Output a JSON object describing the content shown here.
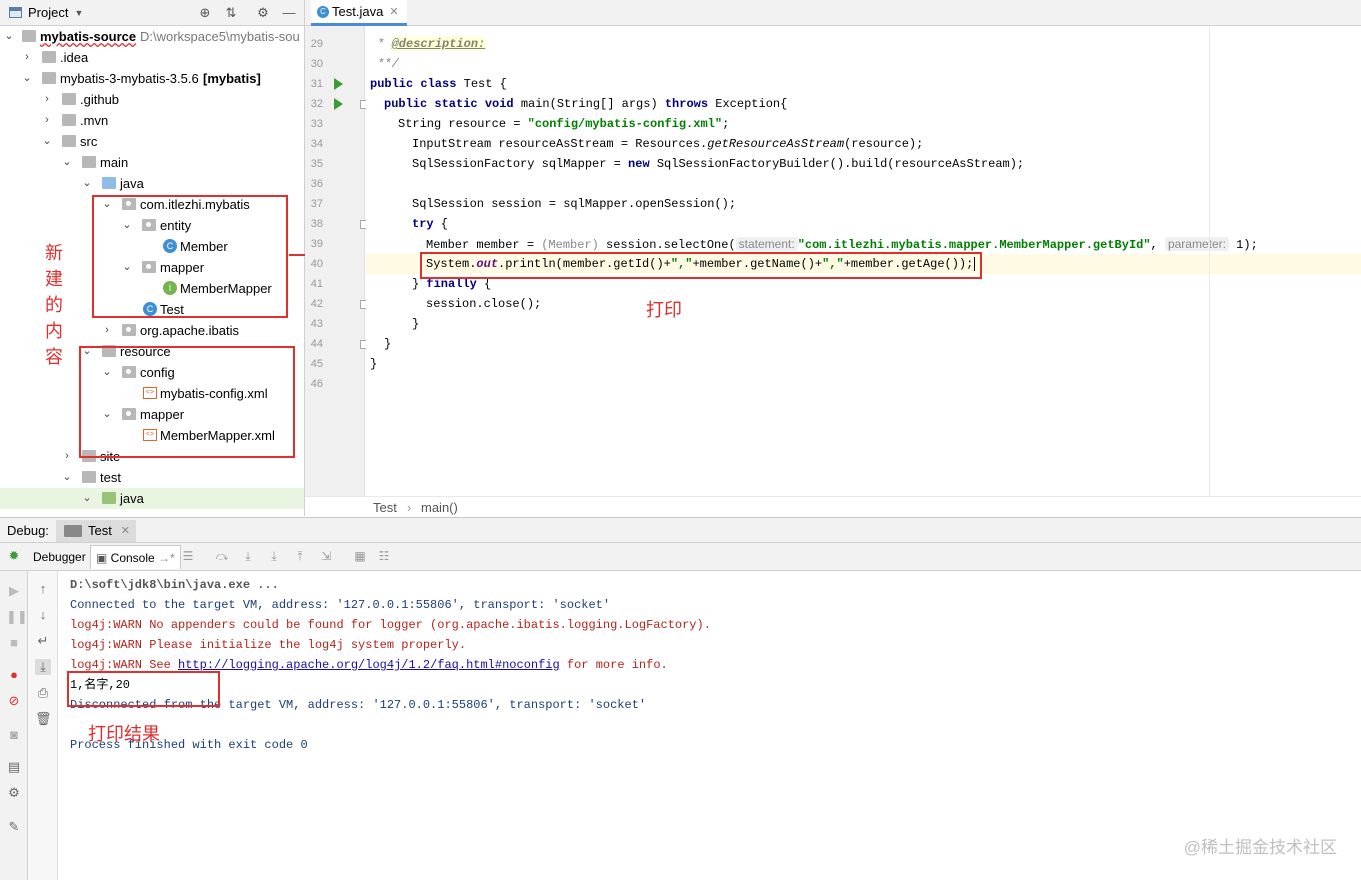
{
  "project_panel": {
    "title": "Project",
    "tree": [
      {
        "label": "mybatis-source",
        "suffix": "D:\\workspace5\\mybatis-sou",
        "bold": true
      },
      {
        "label": ".idea"
      },
      {
        "label": "mybatis-3-mybatis-3.5.6",
        "suffix": "[mybatis]"
      },
      {
        "label": ".github"
      },
      {
        "label": ".mvn"
      },
      {
        "label": "src"
      },
      {
        "label": "main"
      },
      {
        "label": "java"
      },
      {
        "label": "com.itlezhi.mybatis"
      },
      {
        "label": "entity"
      },
      {
        "label": "Member",
        "icon_letter": "C"
      },
      {
        "label": "mapper"
      },
      {
        "label": "MemberMapper",
        "icon_letter": "I"
      },
      {
        "label": "Test",
        "icon_letter": "C"
      },
      {
        "label": "org.apache.ibatis"
      },
      {
        "label": "resource"
      },
      {
        "label": "config"
      },
      {
        "label": "mybatis-config.xml"
      },
      {
        "label": "mapper"
      },
      {
        "label": "MemberMapper.xml"
      },
      {
        "label": "site"
      },
      {
        "label": "test"
      },
      {
        "label": "java"
      }
    ]
  },
  "annotations": {
    "new_content": [
      "新",
      "建",
      "的",
      "内",
      "容"
    ],
    "print": "打印",
    "print_result": "打印结果"
  },
  "editor": {
    "tab_label": "Test.java",
    "breadcrumb": [
      "Test",
      "main()"
    ],
    "line_numbers": [
      "29",
      "30",
      "31",
      "32",
      "33",
      "34",
      "35",
      "36",
      "37",
      "38",
      "39",
      "40",
      "41",
      "42",
      "43",
      "44",
      "45",
      "46"
    ],
    "lines": {
      "l29_star": " * ",
      "l29_tag": "@description:",
      "l30": " **/",
      "l31_kw": "public class",
      "l31_rest": " Test {",
      "l32_kw1": "public static void",
      "l32_mid": " main(String[] args) ",
      "l32_kw2": "throws",
      "l32_rest": " Exception{",
      "l33_a": "String resource = ",
      "l33_str": "\"config/mybatis-config.xml\"",
      "l33_b": ";",
      "l34_a": "InputStream resourceAsStream = Resources.",
      "l34_m": "getResourceAsStream",
      "l34_b": "(resource);",
      "l35_a": "SqlSessionFactory sqlMapper = ",
      "l35_kw": "new",
      "l35_b": " SqlSessionFactoryBuilder().build(resourceAsStream);",
      "l37": "SqlSession session = sqlMapper.openSession();",
      "l38_kw": "try",
      "l38_b": " {",
      "l39_a": "Member member = ",
      "l39_cast": "(Member)",
      "l39_b": " session.selectOne(",
      "l39_hint1": "statement:",
      "l39_str": "\"com.itlezhi.mybatis.mapper.MemberMapper.getById\"",
      "l39_c": ", ",
      "l39_hint2": "parameter:",
      "l39_d": " 1);",
      "l40_a": "System.",
      "l40_fld": "out",
      "l40_b": ".println(member.getId()+",
      "l40_s1": "\",\"",
      "l40_c": "+member.getName()+",
      "l40_s2": "\",\"",
      "l40_d": "+member.getAge());",
      "l41_a": "} ",
      "l41_kw": "finally",
      "l41_b": " {",
      "l42": "session.close();",
      "l43": "}",
      "l44": "}",
      "l45": "}"
    }
  },
  "debug": {
    "label": "Debug:",
    "tab": "Test",
    "tabs": [
      "Debugger",
      "Console"
    ]
  },
  "console": [
    {
      "text": "D:\\soft\\jdk8\\bin\\java.exe ...",
      "kind": "cmd"
    },
    {
      "text": "Connected to the target VM, address: '127.0.0.1:55806', transport: 'socket'",
      "kind": "info"
    },
    {
      "text": "log4j:WARN No appenders could be found for logger (org.apache.ibatis.logging.LogFactory).",
      "kind": "err"
    },
    {
      "text": "log4j:WARN Please initialize the log4j system properly.",
      "kind": "err"
    },
    {
      "text": "log4j:WARN See ",
      "kind": "err",
      "link": "http://logging.apache.org/log4j/1.2/faq.html#noconfig",
      "after": " for more info."
    },
    {
      "text": "1,名字,20",
      "kind": "out"
    },
    {
      "text": "Disconnected from the target VM, address: '127.0.0.1:55806', transport: 'socket'",
      "kind": "info"
    },
    {
      "text": "",
      "kind": "out"
    },
    {
      "text": "Process finished with exit code 0",
      "kind": "info"
    }
  ],
  "watermark": "@稀土掘金技术社区",
  "colors": {
    "annotation_red": "#e0302e",
    "keyword": "#000080",
    "string": "#008000",
    "run_green": "#3b9b37"
  }
}
